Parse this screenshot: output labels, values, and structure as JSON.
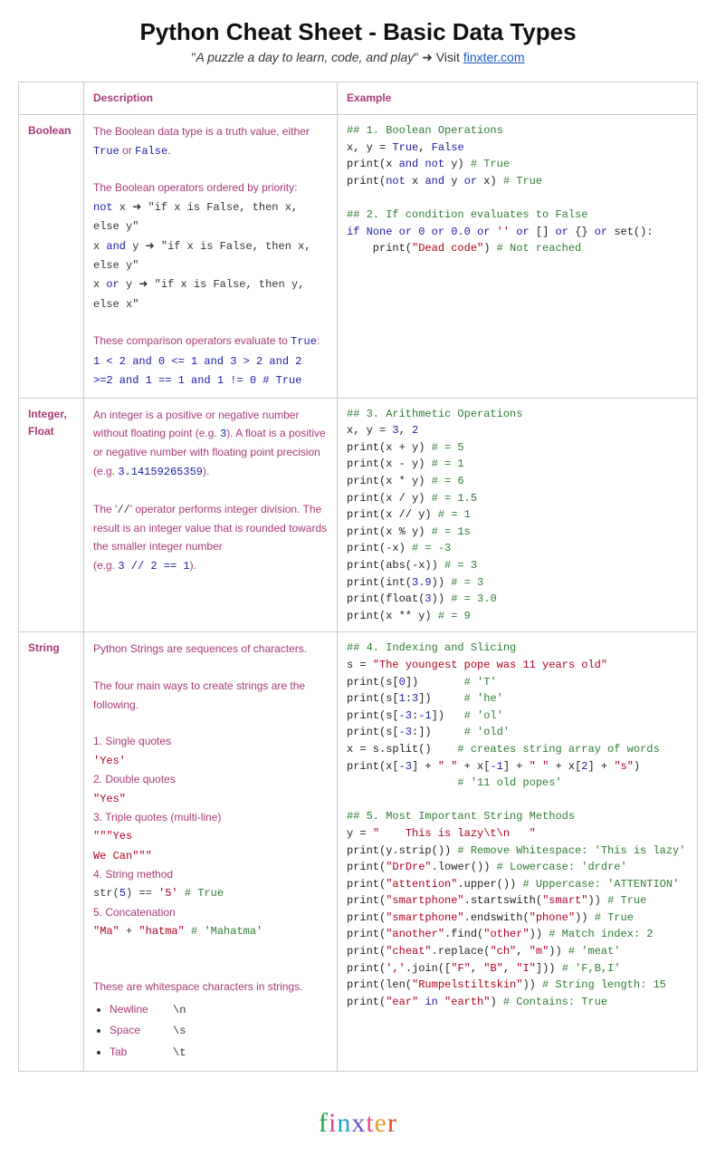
{
  "header": {
    "title": "Python Cheat Sheet - Basic Data Types",
    "subtitle_quote": "A puzzle a day to learn, code, and play",
    "subtitle_suffix": " ➜ Visit ",
    "link_text": "finxter.com"
  },
  "table": {
    "head": {
      "desc": "Description",
      "example": "Example"
    },
    "rows": {
      "boolean": {
        "label": "Boolean"
      },
      "intfloat": {
        "label": "Integer, Float"
      },
      "string": {
        "label": "String"
      }
    }
  },
  "desc": {
    "boolean": {
      "p1a": "The Boolean data type is a truth value, either ",
      "true": "True",
      "or": " or ",
      "false": "False",
      "p1b": ".",
      "p2": "The Boolean operators ordered by priority:",
      "op1_a": "not",
      "op1_b": " x      ➜ \"if x is False, then x, else y\"",
      "op2_a": "x ",
      "op2_b": "and",
      "op2_c": " y ➜ \"if x is False, then x, else y\"",
      "op3_a": "x ",
      "op3_b": "or",
      "op3_c": " y  ➜ \"if x is False, then y, else x\"",
      "p3a": "These comparison operators evaluate to ",
      "p3true": "True",
      "p3b": ":",
      "comp": "1 < 2 and 0 <= 1 and 3 > 2 and 2 >=2 and 1 == 1 and 1 != 0 # True"
    },
    "intfloat": {
      "p1a": "An integer is a positive or negative number without floating point (e.g. ",
      "ex_int": "3",
      "p1b": "). A float is a positive or negative number with floating point precision (e.g.  ",
      "ex_float": "3.14159265359",
      "p1c": ").",
      "p2a": "The '",
      "op": "//",
      "p2b": "' operator performs integer division. The result is an integer value that is rounded towards the smaller integer number",
      "p3a": "(e.g. ",
      "ex_div": "3 // 2 == 1",
      "p3b": ")."
    },
    "string": {
      "p1": "Python Strings are sequences of characters.",
      "p2": "The four main ways to create strings are the following.",
      "m1": "1. Single quotes",
      "m1ex": "'Yes'",
      "m2": "2. Double quotes",
      "m2ex": "\"Yes\"",
      "m3": "3. Triple quotes (multi-line)",
      "m3ex": "\"\"\"Yes\nWe Can\"\"\"",
      "m4": "4. String method",
      "m4ex_a": "str(",
      "m4ex_b": "5",
      "m4ex_c": ") == ",
      "m4ex_d": "'5'",
      "m4ex_e": " # True",
      "m5": "5. Concatenation",
      "m5ex_a": "\"Ma\"",
      "m5ex_b": " + ",
      "m5ex_c": "\"hatma\"",
      "m5ex_d": " # 'Mahatma'",
      "ws_intro": "These are whitespace characters in strings.",
      "ws": [
        {
          "label": "Newline",
          "esc": "\\n"
        },
        {
          "label": "Space",
          "esc": "\\s"
        },
        {
          "label": "Tab",
          "esc": "\\t"
        }
      ]
    }
  },
  "code": {
    "boolean": [
      {
        "t": "cmt",
        "v": "## 1. Boolean Operations"
      },
      {
        "t": "nl"
      },
      {
        "t": "txt",
        "v": "x, y = "
      },
      {
        "t": "kw",
        "v": "True"
      },
      {
        "t": "txt",
        "v": ", "
      },
      {
        "t": "kw",
        "v": "False"
      },
      {
        "t": "nl"
      },
      {
        "t": "txt",
        "v": "print(x "
      },
      {
        "t": "kw",
        "v": "and not"
      },
      {
        "t": "txt",
        "v": " y) "
      },
      {
        "t": "cmt",
        "v": "# True"
      },
      {
        "t": "nl"
      },
      {
        "t": "txt",
        "v": "print("
      },
      {
        "t": "kw",
        "v": "not"
      },
      {
        "t": "txt",
        "v": " x "
      },
      {
        "t": "kw",
        "v": "and"
      },
      {
        "t": "txt",
        "v": " y "
      },
      {
        "t": "kw",
        "v": "or"
      },
      {
        "t": "txt",
        "v": " x) "
      },
      {
        "t": "cmt",
        "v": "# True"
      },
      {
        "t": "nl"
      },
      {
        "t": "nl"
      },
      {
        "t": "cmt",
        "v": "## 2. If condition evaluates to False"
      },
      {
        "t": "nl"
      },
      {
        "t": "kw",
        "v": "if "
      },
      {
        "t": "kw",
        "v": "None"
      },
      {
        "t": "txt",
        "v": " "
      },
      {
        "t": "kw",
        "v": "or"
      },
      {
        "t": "txt",
        "v": " "
      },
      {
        "t": "num",
        "v": "0"
      },
      {
        "t": "txt",
        "v": " "
      },
      {
        "t": "kw",
        "v": "or"
      },
      {
        "t": "txt",
        "v": " "
      },
      {
        "t": "num",
        "v": "0.0"
      },
      {
        "t": "txt",
        "v": " "
      },
      {
        "t": "kw",
        "v": "or"
      },
      {
        "t": "txt",
        "v": " "
      },
      {
        "t": "str",
        "v": "''"
      },
      {
        "t": "txt",
        "v": " "
      },
      {
        "t": "kw",
        "v": "or"
      },
      {
        "t": "txt",
        "v": " [] "
      },
      {
        "t": "kw",
        "v": "or"
      },
      {
        "t": "txt",
        "v": " {} "
      },
      {
        "t": "kw",
        "v": "or"
      },
      {
        "t": "txt",
        "v": " set():"
      },
      {
        "t": "nl"
      },
      {
        "t": "txt",
        "v": "    print("
      },
      {
        "t": "str",
        "v": "\"Dead code\""
      },
      {
        "t": "txt",
        "v": ") "
      },
      {
        "t": "cmt",
        "v": "# Not reached"
      }
    ],
    "intfloat": [
      {
        "t": "cmt",
        "v": "## 3. Arithmetic Operations"
      },
      {
        "t": "nl"
      },
      {
        "t": "txt",
        "v": "x, y = "
      },
      {
        "t": "num",
        "v": "3"
      },
      {
        "t": "txt",
        "v": ", "
      },
      {
        "t": "num",
        "v": "2"
      },
      {
        "t": "nl"
      },
      {
        "t": "txt",
        "v": "print(x + y) "
      },
      {
        "t": "cmt",
        "v": "# = 5"
      },
      {
        "t": "nl"
      },
      {
        "t": "txt",
        "v": "print(x - y) "
      },
      {
        "t": "cmt",
        "v": "# = 1"
      },
      {
        "t": "nl"
      },
      {
        "t": "txt",
        "v": "print(x * y) "
      },
      {
        "t": "cmt",
        "v": "# = 6"
      },
      {
        "t": "nl"
      },
      {
        "t": "txt",
        "v": "print(x / y) "
      },
      {
        "t": "cmt",
        "v": "# = 1.5"
      },
      {
        "t": "nl"
      },
      {
        "t": "txt",
        "v": "print(x // y) "
      },
      {
        "t": "cmt",
        "v": "# = 1"
      },
      {
        "t": "nl"
      },
      {
        "t": "txt",
        "v": "print(x % y) "
      },
      {
        "t": "cmt",
        "v": "# = 1s"
      },
      {
        "t": "nl"
      },
      {
        "t": "txt",
        "v": "print(-x) "
      },
      {
        "t": "cmt",
        "v": "# = -3"
      },
      {
        "t": "nl"
      },
      {
        "t": "txt",
        "v": "print(abs(-x)) "
      },
      {
        "t": "cmt",
        "v": "# = 3"
      },
      {
        "t": "nl"
      },
      {
        "t": "txt",
        "v": "print(int("
      },
      {
        "t": "num",
        "v": "3.9"
      },
      {
        "t": "txt",
        "v": ")) "
      },
      {
        "t": "cmt",
        "v": "# = 3"
      },
      {
        "t": "nl"
      },
      {
        "t": "txt",
        "v": "print(float("
      },
      {
        "t": "num",
        "v": "3"
      },
      {
        "t": "txt",
        "v": ")) "
      },
      {
        "t": "cmt",
        "v": "# = 3.0"
      },
      {
        "t": "nl"
      },
      {
        "t": "txt",
        "v": "print(x ** y) "
      },
      {
        "t": "cmt",
        "v": "# = 9"
      }
    ],
    "string": [
      {
        "t": "cmt",
        "v": "## 4. Indexing and Slicing"
      },
      {
        "t": "nl"
      },
      {
        "t": "txt",
        "v": "s = "
      },
      {
        "t": "str",
        "v": "\"The youngest pope was 11 years old\""
      },
      {
        "t": "nl"
      },
      {
        "t": "txt",
        "v": "print(s["
      },
      {
        "t": "num",
        "v": "0"
      },
      {
        "t": "txt",
        "v": "])       "
      },
      {
        "t": "cmt",
        "v": "# 'T'"
      },
      {
        "t": "nl"
      },
      {
        "t": "txt",
        "v": "print(s["
      },
      {
        "t": "num",
        "v": "1"
      },
      {
        "t": "txt",
        "v": ":"
      },
      {
        "t": "num",
        "v": "3"
      },
      {
        "t": "txt",
        "v": "])     "
      },
      {
        "t": "cmt",
        "v": "# 'he'"
      },
      {
        "t": "nl"
      },
      {
        "t": "txt",
        "v": "print(s["
      },
      {
        "t": "num",
        "v": "-3"
      },
      {
        "t": "txt",
        "v": ":"
      },
      {
        "t": "num",
        "v": "-1"
      },
      {
        "t": "txt",
        "v": "])   "
      },
      {
        "t": "cmt",
        "v": "# 'ol'"
      },
      {
        "t": "nl"
      },
      {
        "t": "txt",
        "v": "print(s["
      },
      {
        "t": "num",
        "v": "-3"
      },
      {
        "t": "txt",
        "v": ":])     "
      },
      {
        "t": "cmt",
        "v": "# 'old'"
      },
      {
        "t": "nl"
      },
      {
        "t": "txt",
        "v": "x = s.split()    "
      },
      {
        "t": "cmt",
        "v": "# creates string array of words"
      },
      {
        "t": "nl"
      },
      {
        "t": "txt",
        "v": "print(x["
      },
      {
        "t": "num",
        "v": "-3"
      },
      {
        "t": "txt",
        "v": "] + "
      },
      {
        "t": "str",
        "v": "\" \""
      },
      {
        "t": "txt",
        "v": " + x["
      },
      {
        "t": "num",
        "v": "-1"
      },
      {
        "t": "txt",
        "v": "] + "
      },
      {
        "t": "str",
        "v": "\" \""
      },
      {
        "t": "txt",
        "v": " + x["
      },
      {
        "t": "num",
        "v": "2"
      },
      {
        "t": "txt",
        "v": "] + "
      },
      {
        "t": "str",
        "v": "\"s\""
      },
      {
        "t": "txt",
        "v": ")"
      },
      {
        "t": "nl"
      },
      {
        "t": "txt",
        "v": "                 "
      },
      {
        "t": "cmt",
        "v": "# '11 old popes'"
      },
      {
        "t": "nl"
      },
      {
        "t": "nl"
      },
      {
        "t": "cmt",
        "v": "## 5. Most Important String Methods"
      },
      {
        "t": "nl"
      },
      {
        "t": "txt",
        "v": "y = "
      },
      {
        "t": "str",
        "v": "\"    This is lazy\\t\\n   \""
      },
      {
        "t": "nl"
      },
      {
        "t": "txt",
        "v": "print(y.strip()) "
      },
      {
        "t": "cmt",
        "v": "# Remove Whitespace: 'This is lazy'"
      },
      {
        "t": "nl"
      },
      {
        "t": "txt",
        "v": "print("
      },
      {
        "t": "str",
        "v": "\"DrDre\""
      },
      {
        "t": "txt",
        "v": ".lower()) "
      },
      {
        "t": "cmt",
        "v": "# Lowercase: 'drdre'"
      },
      {
        "t": "nl"
      },
      {
        "t": "txt",
        "v": "print("
      },
      {
        "t": "str",
        "v": "\"attention\""
      },
      {
        "t": "txt",
        "v": ".upper()) "
      },
      {
        "t": "cmt",
        "v": "# Uppercase: 'ATTENTION'"
      },
      {
        "t": "nl"
      },
      {
        "t": "txt",
        "v": "print("
      },
      {
        "t": "str",
        "v": "\"smartphone\""
      },
      {
        "t": "txt",
        "v": ".startswith("
      },
      {
        "t": "str",
        "v": "\"smart\""
      },
      {
        "t": "txt",
        "v": ")) "
      },
      {
        "t": "cmt",
        "v": "# True"
      },
      {
        "t": "nl"
      },
      {
        "t": "txt",
        "v": "print("
      },
      {
        "t": "str",
        "v": "\"smartphone\""
      },
      {
        "t": "txt",
        "v": ".endswith("
      },
      {
        "t": "str",
        "v": "\"phone\""
      },
      {
        "t": "txt",
        "v": ")) "
      },
      {
        "t": "cmt",
        "v": "# True"
      },
      {
        "t": "nl"
      },
      {
        "t": "txt",
        "v": "print("
      },
      {
        "t": "str",
        "v": "\"another\""
      },
      {
        "t": "txt",
        "v": ".find("
      },
      {
        "t": "str",
        "v": "\"other\""
      },
      {
        "t": "txt",
        "v": ")) "
      },
      {
        "t": "cmt",
        "v": "# Match index: 2"
      },
      {
        "t": "nl"
      },
      {
        "t": "txt",
        "v": "print("
      },
      {
        "t": "str",
        "v": "\"cheat\""
      },
      {
        "t": "txt",
        "v": ".replace("
      },
      {
        "t": "str",
        "v": "\"ch\""
      },
      {
        "t": "txt",
        "v": ", "
      },
      {
        "t": "str",
        "v": "\"m\""
      },
      {
        "t": "txt",
        "v": ")) "
      },
      {
        "t": "cmt",
        "v": "# 'meat'"
      },
      {
        "t": "nl"
      },
      {
        "t": "txt",
        "v": "print("
      },
      {
        "t": "str",
        "v": "','"
      },
      {
        "t": "txt",
        "v": ".join(["
      },
      {
        "t": "str",
        "v": "\"F\""
      },
      {
        "t": "txt",
        "v": ", "
      },
      {
        "t": "str",
        "v": "\"B\""
      },
      {
        "t": "txt",
        "v": ", "
      },
      {
        "t": "str",
        "v": "\"I\""
      },
      {
        "t": "txt",
        "v": "])) "
      },
      {
        "t": "cmt",
        "v": "# 'F,B,I'"
      },
      {
        "t": "nl"
      },
      {
        "t": "txt",
        "v": "print(len("
      },
      {
        "t": "str",
        "v": "\"Rumpelstiltskin\""
      },
      {
        "t": "txt",
        "v": ")) "
      },
      {
        "t": "cmt",
        "v": "# String length: 15"
      },
      {
        "t": "nl"
      },
      {
        "t": "txt",
        "v": "print("
      },
      {
        "t": "str",
        "v": "\"ear\""
      },
      {
        "t": "txt",
        "v": " "
      },
      {
        "t": "kw",
        "v": "in"
      },
      {
        "t": "txt",
        "v": " "
      },
      {
        "t": "str",
        "v": "\"earth\""
      },
      {
        "t": "txt",
        "v": ") "
      },
      {
        "t": "cmt",
        "v": "# Contains: True"
      }
    ]
  },
  "footer": {
    "letters": [
      "f",
      "i",
      "n",
      "x",
      "t",
      "e",
      "r"
    ]
  }
}
